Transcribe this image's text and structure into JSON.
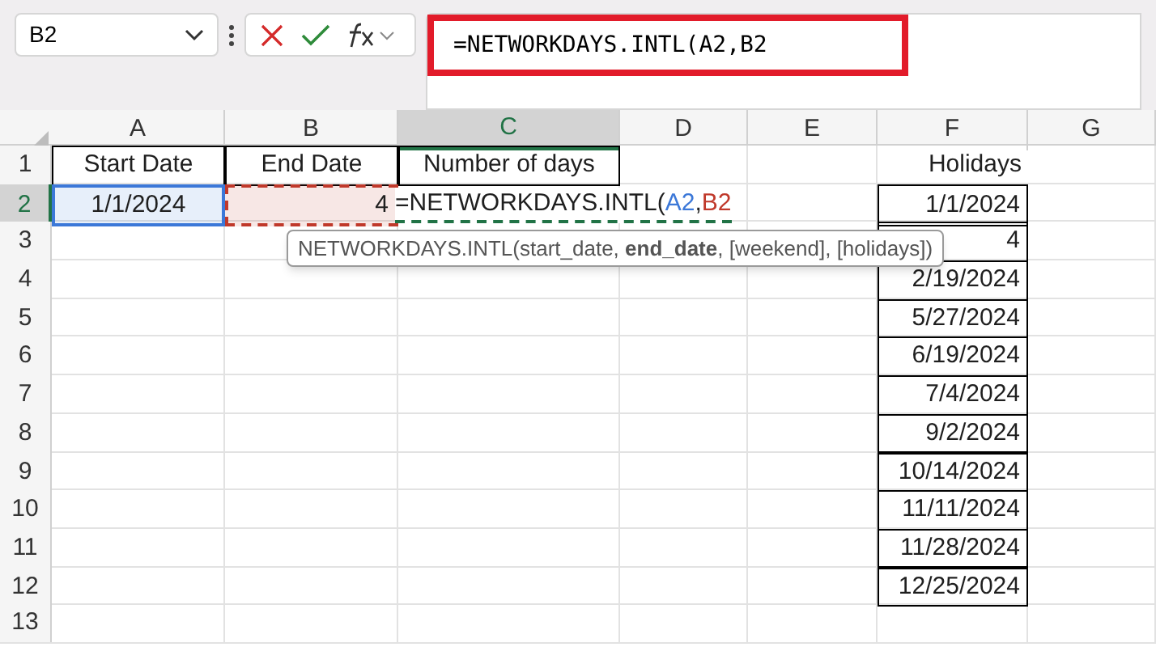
{
  "name_box": {
    "value": "B2"
  },
  "formula_bar": {
    "value": "=NETWORKDAYS.INTL(A2,B2",
    "highlighted": true
  },
  "columns": [
    {
      "label": "A",
      "selected": false
    },
    {
      "label": "B",
      "selected": false
    },
    {
      "label": "C",
      "selected": true
    },
    {
      "label": "D",
      "selected": false
    },
    {
      "label": "E",
      "selected": false
    },
    {
      "label": "F",
      "selected": false
    },
    {
      "label": "G",
      "selected": false
    }
  ],
  "rows": [
    {
      "label": "1",
      "selected": false,
      "cells": [
        {
          "text": "Start Date",
          "boxed": true
        },
        {
          "text": "End Date",
          "boxed": true
        },
        {
          "text": "Number of days",
          "boxed": true
        },
        null,
        null,
        {
          "text": "Holidays",
          "boxed": false
        },
        null
      ]
    },
    {
      "label": "2",
      "selected": true,
      "cells": [
        {
          "text": "1/1/2024",
          "color": "#3c78d8"
        },
        {
          "text": "4",
          "color": "#c0392b"
        },
        null,
        null,
        null,
        {
          "text": "1/1/2024",
          "boxed": true
        },
        null
      ]
    },
    {
      "label": "3",
      "selected": false,
      "cells": [
        null,
        null,
        null,
        null,
        null,
        {
          "text": "4",
          "boxed": true
        },
        null
      ]
    },
    {
      "label": "4",
      "selected": false,
      "cells": [
        null,
        null,
        null,
        null,
        null,
        {
          "text": "2/19/2024",
          "boxed": true
        },
        null
      ]
    },
    {
      "label": "5",
      "selected": false,
      "cells": [
        null,
        null,
        null,
        null,
        null,
        {
          "text": "5/27/2024",
          "boxed": true
        },
        null
      ]
    },
    {
      "label": "6",
      "selected": false,
      "cells": [
        null,
        null,
        null,
        null,
        null,
        {
          "text": "6/19/2024",
          "boxed": true
        },
        null
      ]
    },
    {
      "label": "7",
      "selected": false,
      "cells": [
        null,
        null,
        null,
        null,
        null,
        {
          "text": "7/4/2024",
          "boxed": true
        },
        null
      ]
    },
    {
      "label": "8",
      "selected": false,
      "cells": [
        null,
        null,
        null,
        null,
        null,
        {
          "text": "9/2/2024",
          "boxed": true
        },
        null
      ]
    },
    {
      "label": "9",
      "selected": false,
      "cells": [
        null,
        null,
        null,
        null,
        null,
        {
          "text": "10/14/2024",
          "boxed": true
        },
        null
      ]
    },
    {
      "label": "10",
      "selected": false,
      "cells": [
        null,
        null,
        null,
        null,
        null,
        {
          "text": "11/11/2024",
          "boxed": true
        },
        null
      ]
    },
    {
      "label": "11",
      "selected": false,
      "cells": [
        null,
        null,
        null,
        null,
        null,
        {
          "text": "11/28/2024",
          "boxed": true
        },
        null
      ]
    },
    {
      "label": "12",
      "selected": false,
      "cells": [
        null,
        null,
        null,
        null,
        null,
        {
          "text": "12/25/2024",
          "boxed": true
        },
        null
      ]
    },
    {
      "label": "13",
      "selected": false,
      "cells": [
        null,
        null,
        null,
        null,
        null,
        null,
        null
      ]
    }
  ],
  "cell_editor": {
    "parts": [
      {
        "text": "=NETWORKDAYS.INTL(",
        "color": "#1f1f1f"
      },
      {
        "text": "A2",
        "color": "#3c78d8"
      },
      {
        "text": ",",
        "color": "#1f1f1f"
      },
      {
        "text": "B2",
        "color": "#c0392b"
      }
    ]
  },
  "tooltip": {
    "text": "NETWORKDAYS.INTL(start_date, **end_date**, [weekend], [holidays])"
  }
}
